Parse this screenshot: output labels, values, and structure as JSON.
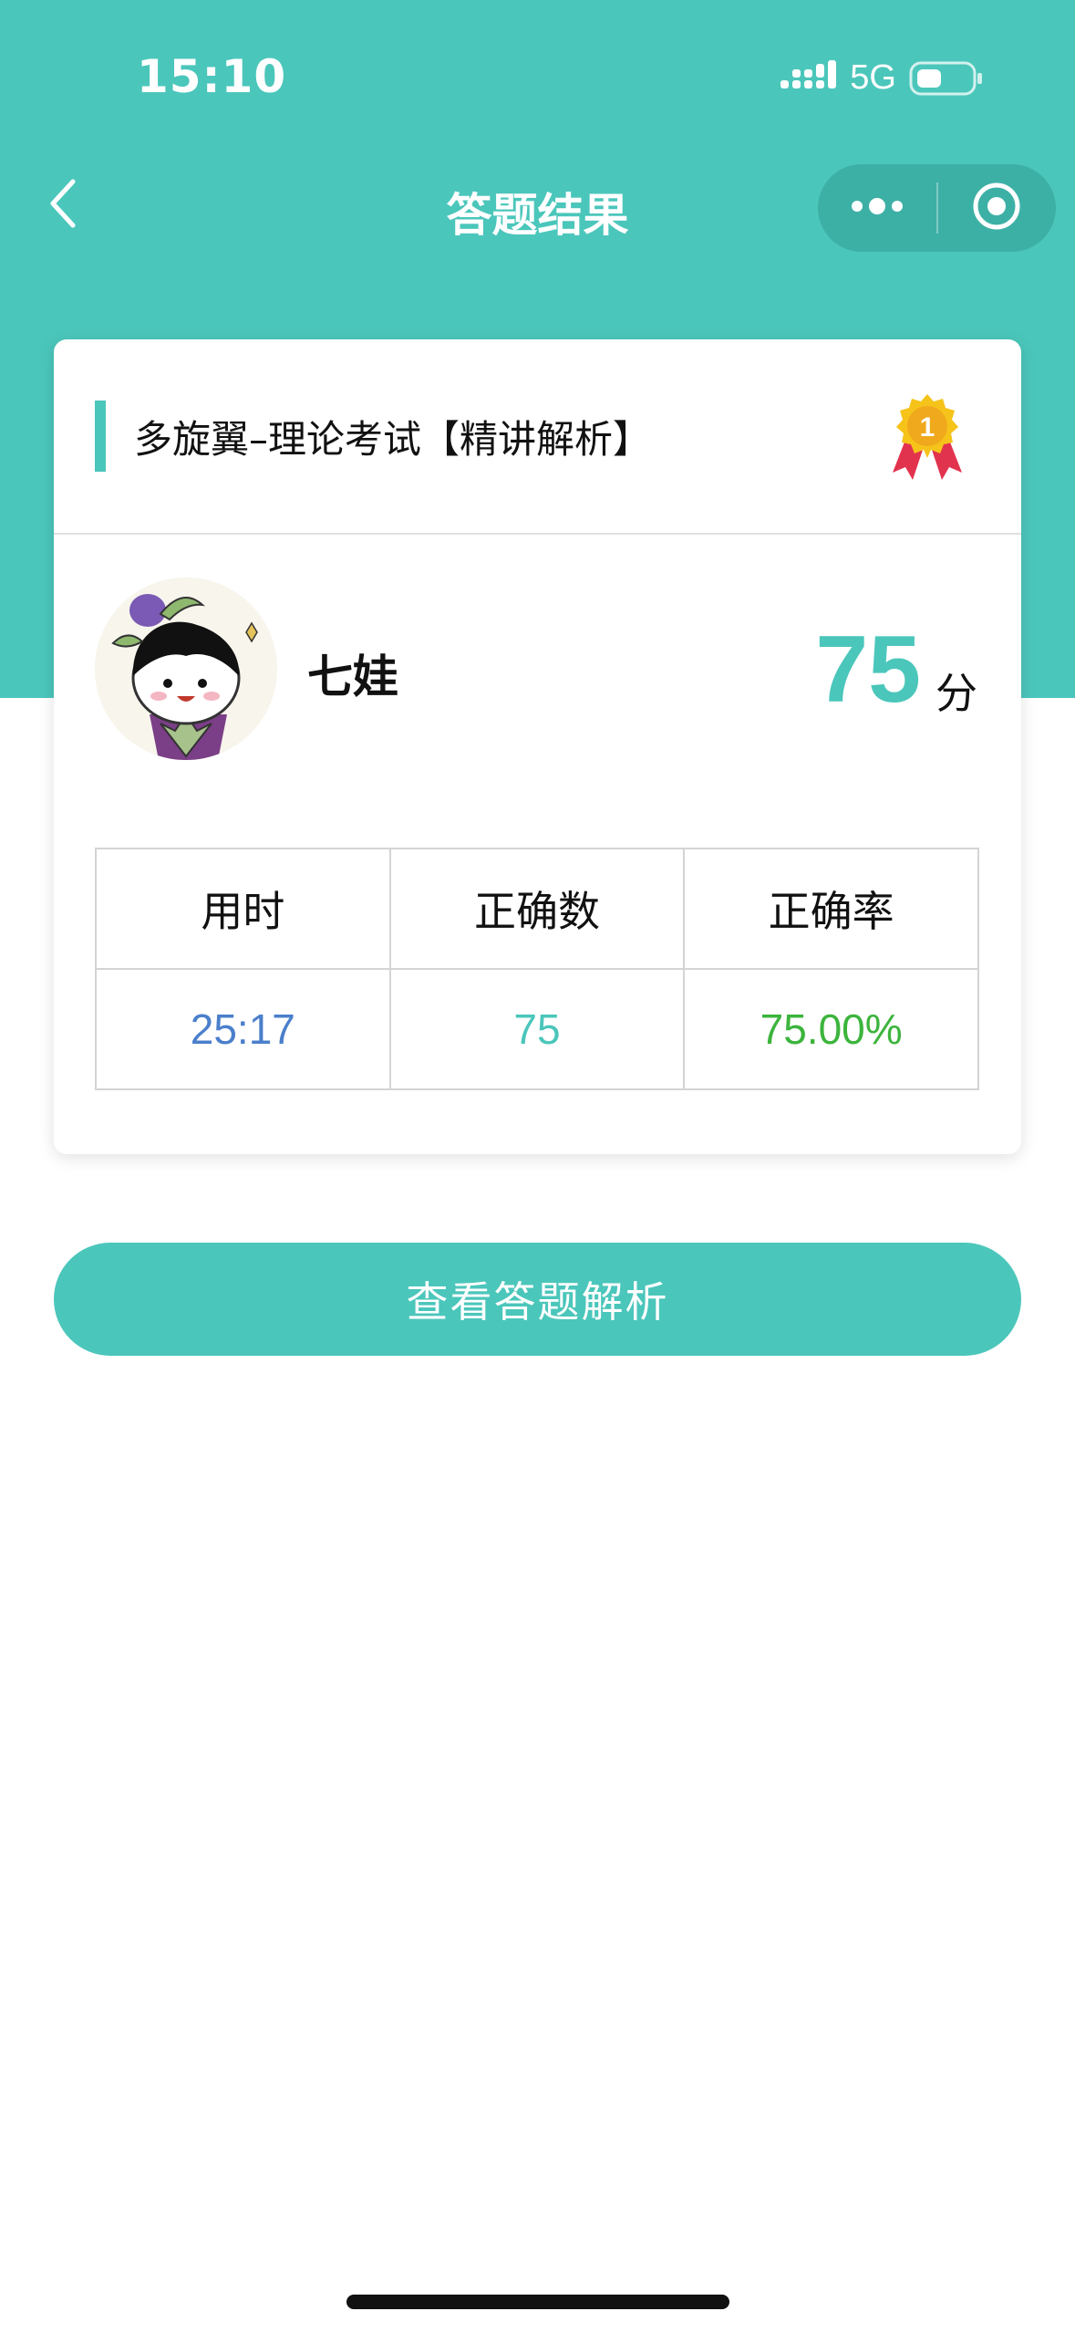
{
  "status_bar": {
    "time": "15:10",
    "network": "5G",
    "signal_icon": "signal-bars-icon",
    "battery_icon": "battery-icon"
  },
  "nav": {
    "title": "答题结果",
    "back_icon": "chevron-left-icon",
    "more_icon": "more-dots-icon",
    "close_icon": "target-circle-icon"
  },
  "card": {
    "exam_title": "多旋翼–理论考试【精讲解析】",
    "medal_rank": "1",
    "user_name": "七娃",
    "score": "75",
    "score_unit": "分",
    "stats": {
      "headers": [
        "用时",
        "正确数",
        "正确率"
      ],
      "values": [
        "25:17",
        "75",
        "75.00%"
      ]
    }
  },
  "actions": {
    "view_analysis_label": "查看答题解析"
  },
  "colors": {
    "accent": "#4bc6bb",
    "time_value": "#4a7fcb",
    "rate_value": "#3cb43c"
  }
}
